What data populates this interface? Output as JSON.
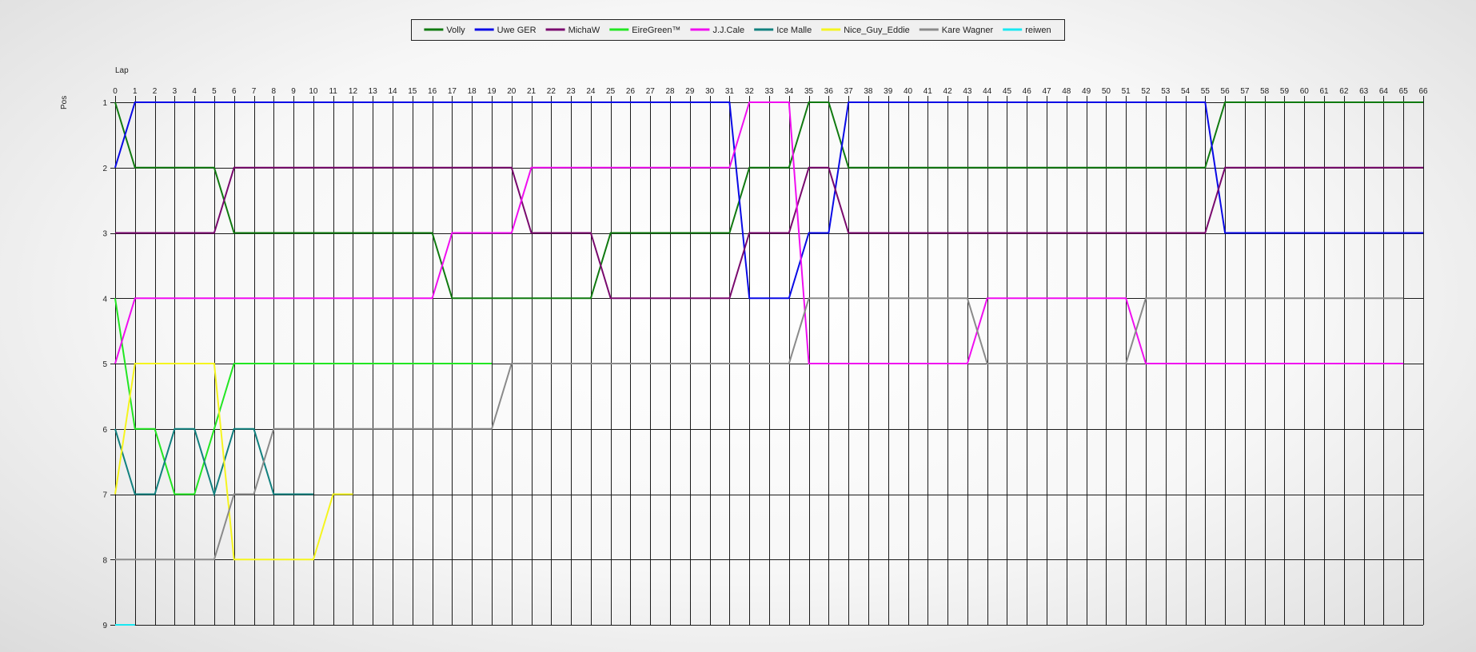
{
  "chart_data": {
    "type": "line",
    "xlabel": "Lap",
    "ylabel": "Pos",
    "x_ticks": [
      0,
      1,
      2,
      3,
      4,
      5,
      6,
      7,
      8,
      9,
      10,
      11,
      12,
      13,
      14,
      15,
      16,
      17,
      18,
      19,
      20,
      21,
      22,
      23,
      24,
      25,
      26,
      27,
      28,
      29,
      30,
      31,
      32,
      33,
      34,
      35,
      36,
      37,
      38,
      39,
      40,
      41,
      42,
      43,
      44,
      45,
      46,
      47,
      48,
      49,
      50,
      51,
      52,
      53,
      54,
      55,
      56,
      57,
      58,
      59,
      60,
      61,
      62,
      63,
      64,
      65,
      66
    ],
    "y_ticks": [
      1,
      2,
      3,
      4,
      5,
      6,
      7,
      8,
      9
    ],
    "xlim": [
      0,
      66
    ],
    "ylim": [
      1,
      9
    ],
    "y_inverted": true,
    "grid": true,
    "legend_position": "top",
    "series": [
      {
        "name": "Volly",
        "color": "#107a10",
        "points": [
          [
            0,
            1
          ],
          [
            1,
            2
          ],
          [
            5,
            2
          ],
          [
            6,
            3
          ],
          [
            16,
            3
          ],
          [
            17,
            4
          ],
          [
            24,
            4
          ],
          [
            25,
            3
          ],
          [
            31,
            3
          ],
          [
            32,
            2
          ],
          [
            34,
            2
          ],
          [
            35,
            1
          ],
          [
            36,
            1
          ],
          [
            37,
            2
          ],
          [
            55,
            2
          ],
          [
            56,
            1
          ],
          [
            66,
            1
          ]
        ]
      },
      {
        "name": "Uwe GER",
        "color": "#0a0ae6",
        "points": [
          [
            0,
            2
          ],
          [
            1,
            1
          ],
          [
            31,
            1
          ],
          [
            32,
            4
          ],
          [
            34,
            4
          ],
          [
            35,
            3
          ],
          [
            36,
            3
          ],
          [
            37,
            1
          ],
          [
            55,
            1
          ],
          [
            56,
            3
          ],
          [
            66,
            3
          ]
        ]
      },
      {
        "name": "MichaW",
        "color": "#7a0a6e",
        "points": [
          [
            0,
            3
          ],
          [
            5,
            3
          ],
          [
            6,
            2
          ],
          [
            20,
            2
          ],
          [
            21,
            3
          ],
          [
            24,
            3
          ],
          [
            25,
            4
          ],
          [
            31,
            4
          ],
          [
            32,
            3
          ],
          [
            34,
            3
          ],
          [
            35,
            2
          ],
          [
            36,
            2
          ],
          [
            37,
            3
          ],
          [
            55,
            3
          ],
          [
            56,
            2
          ],
          [
            66,
            2
          ]
        ]
      },
      {
        "name": "EireGreen™",
        "color": "#22e622",
        "points": [
          [
            0,
            4
          ],
          [
            1,
            6
          ],
          [
            2,
            6
          ],
          [
            3,
            7
          ],
          [
            4,
            7
          ],
          [
            5,
            6
          ],
          [
            6,
            5
          ],
          [
            19,
            5
          ]
        ]
      },
      {
        "name": "J.J.Cale",
        "color": "#f00ef0",
        "points": [
          [
            0,
            5
          ],
          [
            1,
            4
          ],
          [
            16,
            4
          ],
          [
            17,
            3
          ],
          [
            20,
            3
          ],
          [
            21,
            2
          ],
          [
            31,
            2
          ],
          [
            32,
            1
          ],
          [
            34,
            1
          ],
          [
            35,
            5
          ],
          [
            43,
            5
          ],
          [
            44,
            4
          ],
          [
            51,
            4
          ],
          [
            52,
            5
          ],
          [
            65,
            5
          ]
        ]
      },
      {
        "name": "Ice Malle",
        "color": "#12817f",
        "points": [
          [
            0,
            6
          ],
          [
            1,
            7
          ],
          [
            2,
            7
          ],
          [
            3,
            6
          ],
          [
            4,
            6
          ],
          [
            5,
            7
          ],
          [
            6,
            6
          ],
          [
            7,
            6
          ],
          [
            8,
            7
          ],
          [
            10,
            7
          ]
        ]
      },
      {
        "name": "Nice_Guy_Eddie",
        "color": "#f5f51e",
        "points": [
          [
            0,
            7
          ],
          [
            1,
            5
          ],
          [
            5,
            5
          ],
          [
            6,
            8
          ],
          [
            10,
            8
          ],
          [
            11,
            7
          ],
          [
            12,
            7
          ]
        ]
      },
      {
        "name": "Kare Wagner",
        "color": "#8a8a8a",
        "points": [
          [
            0,
            8
          ],
          [
            5,
            8
          ],
          [
            6,
            7
          ],
          [
            7,
            7
          ],
          [
            8,
            6
          ],
          [
            19,
            6
          ],
          [
            20,
            5
          ],
          [
            34,
            5
          ],
          [
            35,
            4
          ],
          [
            43,
            4
          ],
          [
            44,
            5
          ],
          [
            51,
            5
          ],
          [
            52,
            4
          ],
          [
            65,
            4
          ]
        ]
      },
      {
        "name": "reiwen",
        "color": "#19e8f2",
        "points": [
          [
            0,
            9
          ],
          [
            1,
            9
          ]
        ]
      }
    ]
  }
}
